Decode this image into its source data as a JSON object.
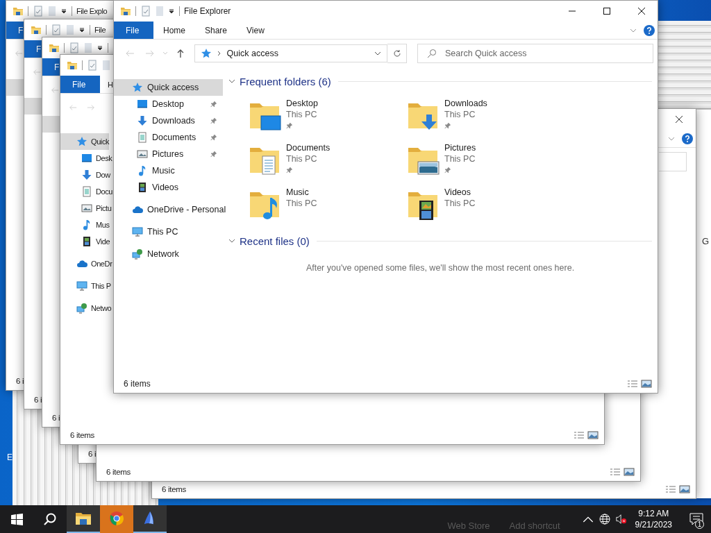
{
  "desktop": {
    "icon_label": "E",
    "far_window_letter": "G"
  },
  "back_windows": [
    {
      "status": "6 items",
      "view_buttons": true,
      "close_button": true,
      "help_button": true,
      "ribbon_toggle": true,
      "search_box": true
    },
    {
      "status": "6 i"
    },
    {
      "status": "6 items",
      "view_buttons": true
    },
    {
      "title": "File Explo",
      "file_tab": "F",
      "back_button": true,
      "nav": [
        {
          "selected": true
        }
      ],
      "status": "6 i"
    },
    {
      "title": "File",
      "file_tab": "F",
      "back_button": true,
      "nav": [
        {
          "selected": true
        }
      ],
      "status": "6 i"
    },
    {
      "file_tab": "F",
      "back_button": true,
      "nav": [
        {
          "selected": true
        }
      ],
      "status": "6 i"
    },
    {
      "file_tab": "File",
      "home_tab": "H",
      "back_button": true,
      "forward_button": true,
      "nav": [
        {
          "label": "Quick",
          "kind": "star",
          "selected": true,
          "children": [
            {
              "label": "Desk",
              "kind": "desktop",
              "selected": false
            },
            {
              "label": "Dow",
              "kind": "downloads",
              "selected": false
            },
            {
              "label": "Docu",
              "kind": "documents",
              "selected": false
            },
            {
              "label": "Pictu",
              "kind": "pictures",
              "selected": false
            },
            {
              "label": "Mus",
              "kind": "music",
              "selected": false
            },
            {
              "label": "Vide",
              "kind": "videos",
              "selected": false
            }
          ]
        },
        {
          "label": "OneDr",
          "kind": "cloud",
          "selected": false
        },
        {
          "label": "This P",
          "kind": "pc",
          "selected": false
        },
        {
          "label": "Netwo",
          "kind": "network",
          "selected": false
        }
      ],
      "status": "6 items",
      "view_buttons": true
    }
  ],
  "window": {
    "title": "File Explorer",
    "tabs": [
      {
        "label": "File",
        "selected": true
      },
      {
        "label": "Home",
        "selected": false
      },
      {
        "label": "Share",
        "selected": false
      },
      {
        "label": "View",
        "selected": false
      }
    ],
    "address": "Quick access",
    "search": {
      "placeholder": "Search Quick access"
    },
    "nav": [
      {
        "label": "Quick access",
        "kind": "star",
        "selected": true,
        "children": [
          {
            "label": "Desktop",
            "kind": "desktop",
            "selected": false,
            "pinned": true
          },
          {
            "label": "Downloads",
            "kind": "downloads",
            "selected": false,
            "pinned": true
          },
          {
            "label": "Documents",
            "kind": "documents",
            "selected": false,
            "pinned": true
          },
          {
            "label": "Pictures",
            "kind": "pictures",
            "selected": false,
            "pinned": true
          },
          {
            "label": "Music",
            "kind": "music",
            "selected": false,
            "pinned": false
          },
          {
            "label": "Videos",
            "kind": "videos",
            "selected": false,
            "pinned": false
          }
        ]
      },
      {
        "label": "OneDrive - Personal",
        "kind": "cloud",
        "selected": false
      },
      {
        "label": "This PC",
        "kind": "pc",
        "selected": false
      },
      {
        "label": "Network",
        "kind": "network",
        "selected": false
      }
    ],
    "frequent": {
      "heading": "Frequent folders (6)",
      "folders": [
        {
          "name": "Desktop",
          "location": "This PC",
          "kind": "desktop",
          "pinned": true
        },
        {
          "name": "Downloads",
          "location": "This PC",
          "kind": "downloads",
          "pinned": true
        },
        {
          "name": "Documents",
          "location": "This PC",
          "kind": "documents",
          "pinned": true
        },
        {
          "name": "Pictures",
          "location": "This PC",
          "kind": "pictures",
          "pinned": true
        },
        {
          "name": "Music",
          "location": "This PC",
          "kind": "music",
          "pinned": false
        },
        {
          "name": "Videos",
          "location": "This PC",
          "kind": "videos",
          "pinned": false
        }
      ]
    },
    "recent": {
      "heading": "Recent files (0)",
      "message": "After you've opened some files, we'll show the most recent ones here."
    },
    "status": "6 items"
  },
  "taskbar": {
    "apps": [
      {
        "kind": "explorer",
        "active": true
      },
      {
        "kind": "chrome",
        "flashing": true
      },
      {
        "kind": "edge",
        "active": true
      }
    ],
    "behind_text": [
      "Web Store",
      "Add shortcut"
    ],
    "time": "9:12 AM",
    "date": "9/21/2023",
    "notifications": "1"
  }
}
